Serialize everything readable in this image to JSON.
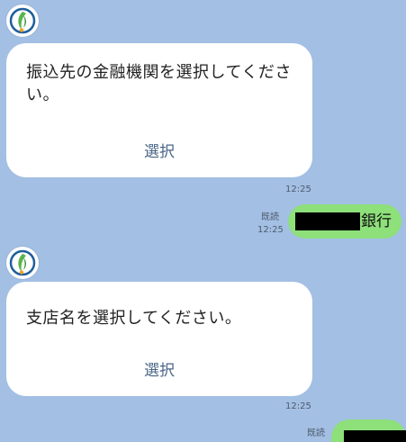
{
  "messages": [
    {
      "sender": "bot",
      "text": "振込先の金融機関を選択してください。",
      "action_label": "選択",
      "time": "12:25"
    },
    {
      "sender": "user",
      "read_label": "既読",
      "time": "12:25",
      "text_suffix": "銀行"
    },
    {
      "sender": "bot",
      "text": "支店名を選択してください。",
      "action_label": "選択",
      "time": "12:25"
    },
    {
      "sender": "user",
      "read_label": "既読"
    }
  ],
  "colors": {
    "chat_background": "#a3bfe3",
    "bot_bubble": "#ffffff",
    "user_bubble": "#8de07a",
    "action_text": "#4a6688",
    "avatar_leaf": "#58b44a",
    "avatar_seed": "#f2a125",
    "avatar_ring": "#1f5e9c"
  },
  "icons": {
    "bot_avatar": "leaf-logo-icon"
  }
}
